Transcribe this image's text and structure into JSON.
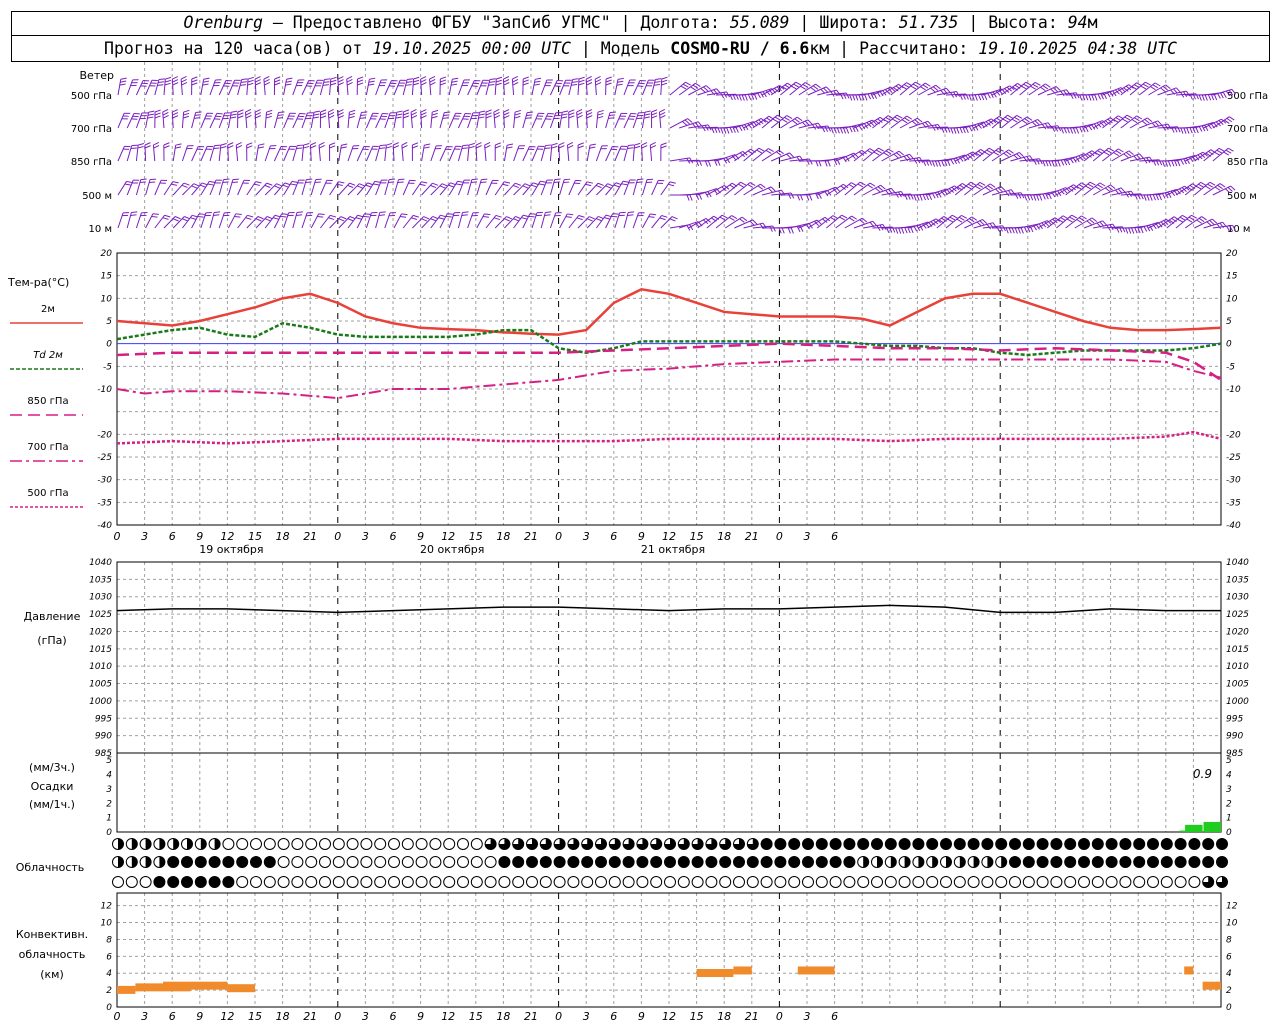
{
  "header": {
    "city": "Orenburg",
    "dash": " — ",
    "provider": "Предоставлено ФГБУ \"ЗапСиб УГМС\"",
    "sep": " | ",
    "lon_label": "Долгота: ",
    "lon_value": "55.089",
    "lat_label": "Широта: ",
    "lat_value": "51.735",
    "alt_label": "Высота: ",
    "alt_value": "94",
    "alt_unit": "м",
    "forecast_label": "Прогноз на 120 часа(ов) от ",
    "forecast_date": "19.10.2025 00:00 UTC",
    "model_sep": "  | ",
    "model_label": "Модель ",
    "model_name": "COSMO-RU / 6.6",
    "model_unit": "км",
    "calc_label": "Рассчитано: ",
    "calc_date": "19.10.2025 04:38 UTC"
  },
  "labels": {
    "wind": "Ветер",
    "wind_levels": [
      "500 гПа",
      "700 гПа",
      "850 гПа",
      "500 м",
      "10  м"
    ],
    "temp": "Тем-ра(°С)",
    "temp_legend": [
      "2м",
      "Td  2м",
      "850 гПа",
      "700 гПа",
      "500 гПа"
    ],
    "pressure": [
      "Давление",
      "(гПа)"
    ],
    "precip": [
      "(мм/3ч.)",
      "Осадки",
      "(мм/1ч.)"
    ],
    "precip_value": "0.9",
    "clouds": "Облачность",
    "conv": [
      "Конвективн.",
      "облачность",
      "(км)"
    ]
  },
  "colors": {
    "t2m": "#e8413a",
    "td2m": "#1a7a1a",
    "t850": "#d61f85",
    "t700": "#d61f85",
    "t500": "#d61f85",
    "wind": "#7a1fbf",
    "zero_line": "#3a3aff",
    "pressure": "#000000",
    "precip": "#1fcc1f",
    "convective": "#f08a2a",
    "grid": "#a0a0a0"
  },
  "icons": {
    "wind_barb": "wind-barb-icon",
    "cloud_cover": "cloud-cover-circle-icon"
  },
  "chart_data": [
    {
      "type": "wind-barbs",
      "levels": [
        "500 гПа",
        "700 гПа",
        "850 гПа",
        "500 м",
        "10  м"
      ],
      "x_hours": [
        0,
        120
      ],
      "note_time_step_hours": 1
    },
    {
      "type": "line",
      "ylabel": "Тем-ра(°С)",
      "ylim": [
        -40,
        20
      ],
      "yticks": [
        20,
        15,
        10,
        5,
        0,
        -5,
        -10,
        -20,
        -25,
        -30,
        -35,
        -40
      ],
      "x_tick_labels": [
        "0",
        "3",
        "6",
        "9",
        "12",
        "15",
        "18",
        "21",
        "0",
        "3",
        "6",
        "9",
        "12",
        "15",
        "18",
        "21",
        "0",
        "3",
        "6",
        "9",
        "12",
        "15",
        "18",
        "21",
        "0",
        "3",
        "6"
      ],
      "date_labels": [
        "19 октября",
        "20 октября",
        "21 октября"
      ],
      "series": [
        {
          "name": "2м",
          "x": [
            0,
            3,
            6,
            9,
            12,
            15,
            18,
            21,
            24,
            27,
            30,
            33,
            36,
            39,
            42,
            45,
            48,
            51,
            54,
            57,
            60,
            63,
            66,
            69,
            72,
            75,
            78,
            81,
            84,
            87,
            90,
            93,
            96,
            99,
            102,
            105,
            108,
            111,
            114,
            117,
            120
          ],
          "values": [
            5,
            4.5,
            4,
            5,
            6.5,
            8,
            10,
            11,
            9,
            6,
            4.5,
            3.5,
            3.2,
            3,
            2.5,
            2.2,
            2,
            3,
            9,
            12,
            11,
            9,
            7,
            6.5,
            6,
            6,
            6,
            5.5,
            4,
            7,
            10,
            11,
            11,
            9,
            7,
            5,
            3.5,
            3,
            3,
            3.2,
            3.5
          ]
        },
        {
          "name": "Td  2м",
          "x": [
            0,
            3,
            6,
            9,
            12,
            15,
            18,
            21,
            24,
            27,
            30,
            33,
            36,
            39,
            42,
            45,
            48,
            51,
            54,
            57,
            60,
            63,
            66,
            69,
            72,
            75,
            78,
            81,
            84,
            87,
            90,
            93,
            96,
            99,
            102,
            105,
            108,
            111,
            114,
            117,
            120
          ],
          "values": [
            1,
            2,
            3,
            3.5,
            2,
            1.5,
            4.5,
            3.5,
            2,
            1.5,
            1.5,
            1.5,
            1.5,
            2,
            3,
            3,
            -1,
            -2,
            -1,
            0.5,
            0.5,
            0.5,
            0.5,
            0.5,
            0.5,
            0.5,
            0.5,
            0,
            -0.5,
            -0.5,
            -1,
            -1,
            -2,
            -2.5,
            -2,
            -1.5,
            -1.5,
            -1.5,
            -1.5,
            -1,
            0
          ]
        },
        {
          "name": "850 гПа",
          "x": [
            0,
            6,
            12,
            18,
            24,
            30,
            36,
            42,
            48,
            54,
            60,
            66,
            72,
            78,
            84,
            90,
            96,
            102,
            108,
            114,
            117,
            120
          ],
          "values": [
            -2.5,
            -2,
            -2,
            -2,
            -2,
            -2,
            -2,
            -2,
            -2,
            -1.5,
            -1,
            -0.5,
            0,
            -0.5,
            -1,
            -1,
            -1.5,
            -1,
            -1.5,
            -2,
            -4,
            -8
          ]
        },
        {
          "name": "700 гПа",
          "x": [
            0,
            3,
            6,
            12,
            18,
            24,
            30,
            36,
            42,
            48,
            54,
            60,
            66,
            72,
            78,
            84,
            90,
            96,
            102,
            108,
            114,
            117,
            120
          ],
          "values": [
            -10,
            -11,
            -10.5,
            -10.5,
            -11,
            -12,
            -10,
            -10,
            -9,
            -8,
            -6,
            -5.5,
            -4.5,
            -4,
            -3.5,
            -3.5,
            -3.5,
            -3.5,
            -3.5,
            -3.5,
            -4,
            -6,
            -7.5
          ]
        },
        {
          "name": "500 гПа",
          "x": [
            0,
            6,
            12,
            18,
            24,
            30,
            36,
            42,
            48,
            54,
            60,
            66,
            72,
            78,
            84,
            90,
            96,
            102,
            108,
            114,
            117,
            120
          ],
          "values": [
            -22,
            -21.5,
            -22,
            -21.5,
            -21,
            -21,
            -21,
            -21.5,
            -21.5,
            -21.5,
            -21,
            -21,
            -21,
            -21,
            -21.5,
            -21,
            -21,
            -21,
            -21,
            -20.5,
            -19.5,
            -21
          ]
        }
      ]
    },
    {
      "type": "line",
      "ylabel": "Давление (гПа)",
      "ylim": [
        985,
        1040
      ],
      "yticks": [
        1040,
        1035,
        1030,
        1025,
        1020,
        1015,
        1010,
        1005,
        1000,
        995,
        990,
        985
      ],
      "series": [
        {
          "name": "Давление",
          "x": [
            0,
            6,
            12,
            18,
            24,
            30,
            36,
            42,
            48,
            54,
            60,
            66,
            72,
            78,
            84,
            90,
            96,
            102,
            108,
            114,
            120
          ],
          "values": [
            1026,
            1026.5,
            1026.5,
            1026,
            1025.5,
            1026,
            1026.5,
            1027,
            1027,
            1026.5,
            1026,
            1026.5,
            1026.5,
            1027,
            1027.5,
            1027,
            1025.5,
            1025.5,
            1026.5,
            1026,
            1026
          ]
        }
      ]
    },
    {
      "type": "bar",
      "ylabel": "Осадки",
      "ylim": [
        0,
        5
      ],
      "annotation": "0.9",
      "x": [
        117,
        119
      ],
      "values": [
        0.5,
        0.7
      ]
    },
    {
      "type": "bar",
      "ylabel": "Конвективн. облачность (км)",
      "ylim": [
        0,
        12
      ],
      "yticks": [
        12,
        10,
        8,
        6,
        4,
        2,
        0
      ],
      "segments": [
        {
          "x": [
            0,
            2
          ],
          "values": [
            2.5,
            2.5
          ]
        },
        {
          "x": [
            2,
            8
          ],
          "values": [
            2.8,
            2.8
          ]
        },
        {
          "x": [
            5,
            12
          ],
          "values": [
            3,
            3
          ]
        },
        {
          "x": [
            12,
            15
          ],
          "values": [
            2.7,
            2.7
          ]
        },
        {
          "x": [
            63,
            67
          ],
          "values": [
            4.5,
            4.5
          ]
        },
        {
          "x": [
            67,
            69
          ],
          "values": [
            4.8,
            4.8
          ]
        },
        {
          "x": [
            74,
            78
          ],
          "values": [
            4.8,
            4.8
          ]
        },
        {
          "x": [
            116,
            117
          ],
          "values": [
            4.8,
            4.8
          ]
        },
        {
          "x": [
            118,
            120
          ],
          "values": [
            2.7,
            3
          ]
        }
      ]
    }
  ]
}
